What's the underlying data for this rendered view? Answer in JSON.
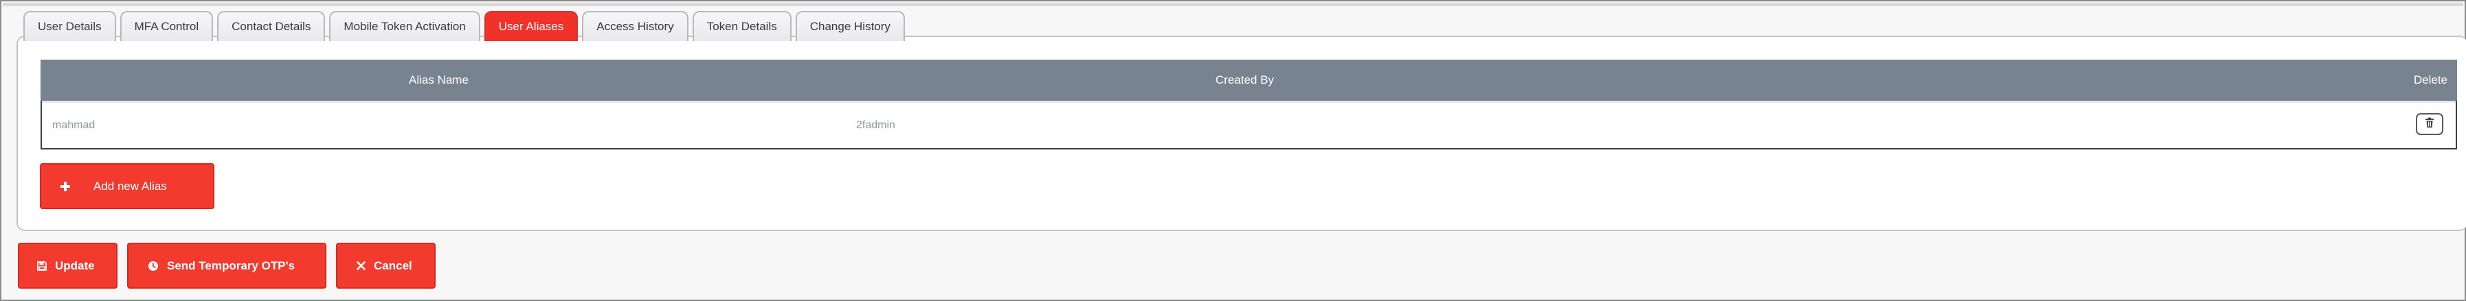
{
  "tabs": [
    {
      "label": "User Details",
      "active": false
    },
    {
      "label": "MFA Control",
      "active": false
    },
    {
      "label": "Contact Details",
      "active": false
    },
    {
      "label": "Mobile Token Activation",
      "active": false
    },
    {
      "label": "User Aliases",
      "active": true
    },
    {
      "label": "Access History",
      "active": false
    },
    {
      "label": "Token Details",
      "active": false
    },
    {
      "label": "Change History",
      "active": false
    }
  ],
  "table": {
    "headers": {
      "alias_name": "Alias Name",
      "created_by": "Created By",
      "delete": "Delete"
    },
    "rows": [
      {
        "alias_name": "mahmad",
        "created_by": "2fadmin",
        "delete_icon": "trash-icon"
      }
    ]
  },
  "buttons": {
    "add_alias": {
      "label": "Add new Alias",
      "icon": "plus-icon"
    },
    "update": {
      "label": "Update",
      "icon": "save-icon"
    },
    "send_otp": {
      "label": "Send Temporary OTP's",
      "icon": "clock-icon"
    },
    "cancel": {
      "label": "Cancel",
      "icon": "close-icon"
    }
  },
  "colors": {
    "accent": "#f23a2f",
    "table_header": "#77838f",
    "cell_text": "#8d96a3"
  }
}
